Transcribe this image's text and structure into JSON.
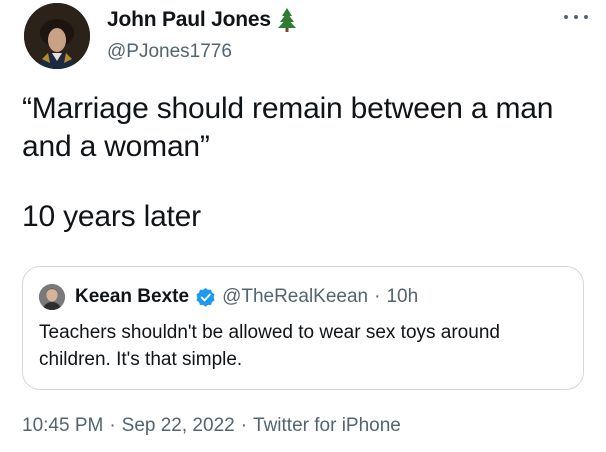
{
  "tweet": {
    "author": {
      "name": "John Paul Jones",
      "handle": "@PJones1776",
      "badge_icon": "tree-icon",
      "avatar_icon": "portrait-avatar"
    },
    "more_icon": "more-icon",
    "text_line_1": "“Marriage should remain between a man and a woman”",
    "text_line_2": "10 years later",
    "quoted": {
      "name": "Keean Bexte",
      "verified_icon": "verified-icon",
      "handle": "@TheRealKeean",
      "separator": "·",
      "time": "10h",
      "text": "Teachers shouldn't be allowed to wear sex toys around children. It's that simple."
    },
    "meta": {
      "time": "10:45 PM",
      "separator": "·",
      "date": "Sep 22, 2022",
      "source": "Twitter for iPhone"
    }
  },
  "colors": {
    "text": "#0f1419",
    "secondary": "#536471",
    "border": "#cfd9de",
    "verified": "#1d9bf0",
    "tree": "#2e7d32"
  }
}
